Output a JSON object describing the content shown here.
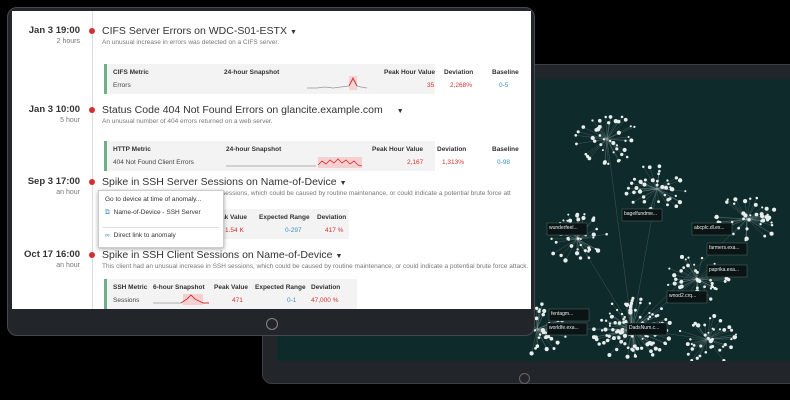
{
  "anomalies": [
    {
      "time": "Jan 3 19:00",
      "duration": "2 hours",
      "title": "CIFS Server Errors on WDC-S01-ESTX",
      "description": "An unusual increase in errors was detected on a CIFS server.",
      "metric_header": "CIFS Metric",
      "metric_name": "Errors",
      "snapshot_label": "24-hour Snapshot",
      "col1_label": "Peak Hour Value",
      "col1_value": "35",
      "col2_label": "Deviation",
      "col2_value": "2,268%",
      "col3_label": "Baseline",
      "col3_value": "0-5"
    },
    {
      "time": "Jan 3 10:00",
      "duration": "5 hour",
      "title": "Status Code 404 Not Found Errors on glancite.example.com",
      "description": "An unusual number of 404 errors returned on a web server.",
      "metric_header": "HTTP Metric",
      "metric_name": "404 Not Found Client Errors",
      "snapshot_label": "24-hour Snapshot",
      "col1_label": "Peak Hour Value",
      "col1_value": "2,167",
      "col2_label": "Deviation",
      "col2_value": "1,313%",
      "col3_label": "Baseline",
      "col3_value": "0-98"
    },
    {
      "time": "Sep 3 17:00",
      "duration": "an hour",
      "title": "Spike in SSH Server Sessions on Name-of-Device",
      "description": "sessions, which could be caused by routine maintenance, or could indicate a potential brute force att",
      "col1_label": "ak Value",
      "col1_value": "1.54 K",
      "col2_label": "Expected Range",
      "col2_value": "0-297",
      "col3_label": "Deviation",
      "col3_value": "417 %"
    },
    {
      "time": "Oct 17 16:00",
      "duration": "an hour",
      "title": "Spike in SSH Client Sessions on Name-of-Device",
      "description": "This client had an unusual increase in SSH sessions, which could be caused by routine maintenance, or could indicate a potential brute force attack.",
      "metric_header": "SSH Metric",
      "metric_name": "Sessions",
      "snapshot_label": "6-hour Snapshot",
      "col1_label": "Peak Value",
      "col1_value": "471",
      "col2_label": "Expected Range",
      "col2_value": "0-1",
      "col3_label": "Deviation",
      "col3_value": "47,000 %"
    }
  ],
  "dropdown": {
    "header": "Go to device at time of anomaly...",
    "item1": "Name-of-Device - SSH Server",
    "item2": "Direct link to anomaly",
    "item1_icon": "external-link-icon",
    "item2_icon": "link-icon"
  },
  "graph": {
    "labels": [
      "wunderfeel...",
      "bagelfundme...",
      "abcplc.dl.ex...",
      "farmers.exa...",
      "paprika.exa...",
      "wnod2.crq...",
      "DadsNum.c...",
      "worldfe.exa...",
      "fentagm..."
    ]
  },
  "colors": {
    "accent_red": "#d32f2f",
    "accent_blue": "#3b8fc5",
    "metric_border": "#6fb08a"
  }
}
